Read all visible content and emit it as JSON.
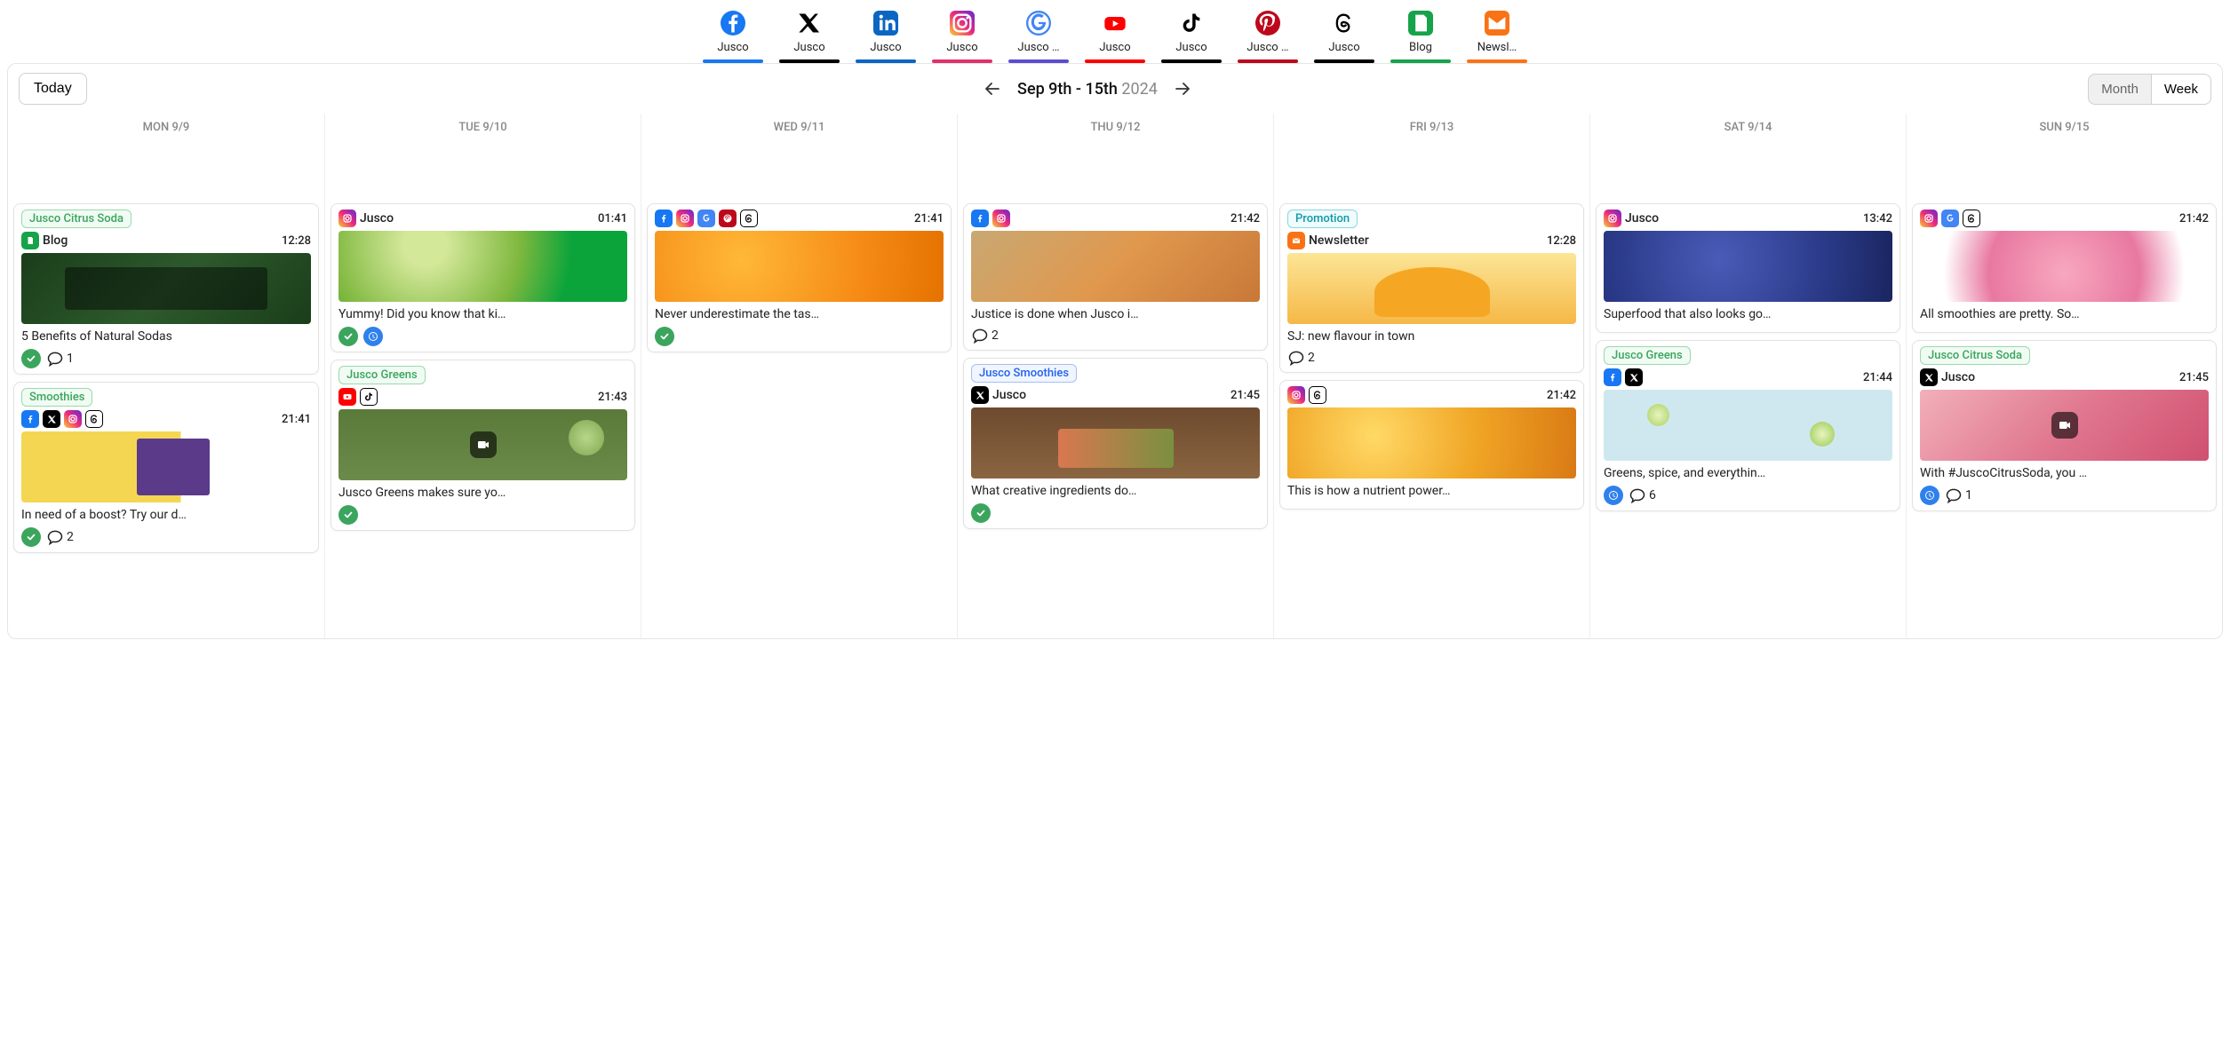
{
  "channels": [
    {
      "id": "facebook",
      "label": "Jusco",
      "underline": "#1877f2"
    },
    {
      "id": "x",
      "label": "Jusco",
      "underline": "#000000"
    },
    {
      "id": "linkedin",
      "label": "Jusco",
      "underline": "#0a66c2"
    },
    {
      "id": "instagram",
      "label": "Jusco",
      "underline": "#e1306c"
    },
    {
      "id": "gmb",
      "label": "Jusco …",
      "underline": "#5b4dd1"
    },
    {
      "id": "youtube",
      "label": "Jusco",
      "underline": "#ff0000"
    },
    {
      "id": "tiktok",
      "label": "Jusco",
      "underline": "#000000"
    },
    {
      "id": "pinterest",
      "label": "Jusco …",
      "underline": "#bd081c"
    },
    {
      "id": "threads",
      "label": "Jusco",
      "underline": "#000000"
    },
    {
      "id": "blog",
      "label": "Blog",
      "underline": "#16a34a"
    },
    {
      "id": "newsletter",
      "label": "Newsl…",
      "underline": "#f97316"
    }
  ],
  "nav": {
    "today": "Today",
    "range_black": "Sep 9th - 15th",
    "range_gray": "2024",
    "month": "Month",
    "week": "Week",
    "active_view": "Month"
  },
  "days": [
    "MON 9/9",
    "TUE 9/10",
    "WED 9/11",
    "THU 9/12",
    "FRI 9/13",
    "SAT 9/14",
    "SUN 9/15"
  ],
  "cards": {
    "mon1": {
      "tag": "Jusco Citrus Soda",
      "tag_style": "green",
      "sub_label": "Blog",
      "sub_icons": [
        "blog"
      ],
      "time": "12:28",
      "img": "img-leaves",
      "text": "5 Benefits of Natural Sodas",
      "status": [
        "check"
      ],
      "comments": "1"
    },
    "mon2": {
      "tag": "Smoothies",
      "tag_style": "green",
      "sub_icons": [
        "facebook",
        "x",
        "instagram",
        "threads"
      ],
      "time": "21:41",
      "img": "img-bottle",
      "text": "In need of a boost? Try our d…",
      "status": [
        "check"
      ],
      "comments": "2"
    },
    "tue1": {
      "sub_label": "Jusco",
      "sub_icons": [
        "instagram"
      ],
      "time": "01:41",
      "img": "img-kiwi",
      "text": "Yummy! Did you know that ki…",
      "status": [
        "check",
        "clock"
      ]
    },
    "tue2": {
      "tag": "Jusco Greens",
      "tag_style": "green",
      "sub_icons": [
        "youtube",
        "tiktok"
      ],
      "time": "21:43",
      "img": "img-avocado",
      "video": true,
      "text": "Jusco Greens makes sure yo…",
      "status": [
        "check"
      ]
    },
    "wed1": {
      "sub_icons": [
        "facebook",
        "instagram",
        "gmb",
        "pinterest",
        "threads"
      ],
      "time": "21:41",
      "img": "img-orange",
      "text": "Never underestimate the tas…",
      "status": [
        "check"
      ]
    },
    "thu1": {
      "sub_icons": [
        "facebook",
        "instagram"
      ],
      "time": "21:42",
      "img": "img-orange2",
      "text": "Justice is done when Jusco i…",
      "comments": "2"
    },
    "thu2": {
      "tag": "Jusco Smoothies",
      "tag_style": "blue",
      "sub_label": "Jusco",
      "sub_icons": [
        "x"
      ],
      "time": "21:45",
      "img": "img-smoothie",
      "video": true,
      "text": "What creative ingredients do…",
      "status": [
        "check"
      ]
    },
    "fri1": {
      "tag": "Promotion",
      "tag_style": "cyan",
      "sub_label": "Newsletter",
      "sub_icons": [
        "newsletter"
      ],
      "time": "12:28",
      "img": "img-juice",
      "text": "SJ: new flavour in town",
      "comments": "2"
    },
    "fri2": {
      "sub_icons": [
        "instagram",
        "threads"
      ],
      "time": "21:42",
      "img": "img-lemons",
      "text": "This is how a nutrient power…"
    },
    "sat1": {
      "sub_label": "Jusco",
      "sub_icons": [
        "instagram"
      ],
      "time": "13:42",
      "img": "img-blueberry",
      "text": "Superfood that also looks go…"
    },
    "sat2": {
      "tag": "Jusco Greens",
      "tag_style": "green",
      "sub_icons": [
        "facebook",
        "x"
      ],
      "time": "21:44",
      "img": "img-limes",
      "text": "Greens, spice, and everythin…",
      "status": [
        "clock"
      ],
      "comments": "6"
    },
    "sun1": {
      "sub_icons": [
        "instagram",
        "gmb",
        "threads"
      ],
      "time": "21:42",
      "img": "img-bowl",
      "text": "All smoothies are pretty. So…"
    },
    "sun2": {
      "tag": "Jusco Citrus Soda",
      "tag_style": "green",
      "sub_label": "Jusco",
      "sub_icons": [
        "x"
      ],
      "time": "21:45",
      "img": "img-pink",
      "video": true,
      "text": "With #JuscoCitrusSoda, you …",
      "status": [
        "clock"
      ],
      "comments": "1"
    }
  }
}
